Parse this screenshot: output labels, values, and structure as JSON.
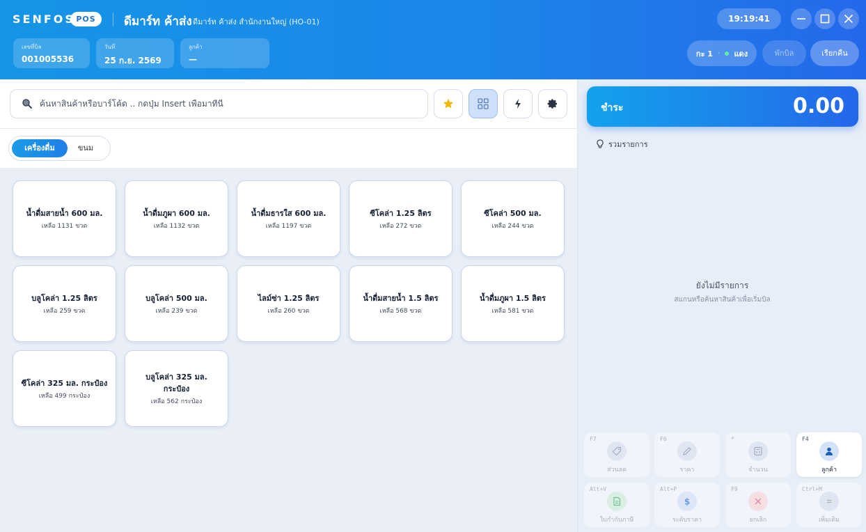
{
  "header": {
    "brand": "SENFOS",
    "badge": "POS",
    "store_name": "ดีมาร์ท ค้าส่ง",
    "branch": "ดีมาร์ท ค้าส่ง สำนักงานใหญ่ (HO-01)",
    "bill_label": "เลขที่บิล",
    "bill_value": "001005536",
    "date_label": "วันที่",
    "date_value": "25 ก.ย. 2569",
    "customer_label": "ลูกค้า",
    "customer_value": "—",
    "time": "19:19:41",
    "shift": "กะ 1",
    "shift_sep": "·",
    "cashier": "แดง",
    "hold_label": "พักบิล",
    "recall_label": "เรียกคืน"
  },
  "search": {
    "placeholder": "ค้นหาสินค้าหรือบาร์โค้ด .. กดปุ่ม Insert เพื่อมาที่นี่"
  },
  "categories": [
    {
      "label": "เครื่องดื่ม"
    },
    {
      "label": "ขนม"
    }
  ],
  "products": [
    {
      "name": "น้ำดื่มสายน้ำ 600 มล.",
      "stock": "เหลือ 1131 ขวด"
    },
    {
      "name": "น้ำดื่มภูผา 600 มล.",
      "stock": "เหลือ 1132 ขวด"
    },
    {
      "name": "น้ำดื่มธารใส 600 มล.",
      "stock": "เหลือ 1197 ขวด"
    },
    {
      "name": "ซีโคล่า 1.25 ลิตร",
      "stock": "เหลือ 272 ขวด"
    },
    {
      "name": "ซีโคล่า 500 มล.",
      "stock": "เหลือ 244 ขวด"
    },
    {
      "name": "บลูโคล่า 1.25 ลิตร",
      "stock": "เหลือ 259 ขวด"
    },
    {
      "name": "บลูโคล่า 500 มล.",
      "stock": "เหลือ 239 ขวด"
    },
    {
      "name": "ไลม์ซ่า 1.25 ลิตร",
      "stock": "เหลือ 260 ขวด"
    },
    {
      "name": "น้ำดื่มสายน้ำ 1.5 ลิตร",
      "stock": "เหลือ 568 ขวด"
    },
    {
      "name": "น้ำดื่มภูผา 1.5 ลิตร",
      "stock": "เหลือ 581 ขวด"
    },
    {
      "name": "ซีโคล่า 325 มล. กระป๋อง",
      "stock": "เหลือ 499 กระป๋อง"
    },
    {
      "name": "บลูโคล่า 325 มล. กระป๋อง",
      "stock": "เหลือ 562 กระป๋อง"
    }
  ],
  "cart": {
    "pay_label": "ชำระ",
    "total": "0.00",
    "summary_label": "รวมรายการ",
    "empty_title": "ยังไม่มีรายการ",
    "empty_subtitle": "สแกนหรือค้นหาสินค้าเพื่อเริ่มบิล"
  },
  "actions": [
    {
      "key": "F7",
      "label": "ส่วนลด",
      "icon": "tag-icon"
    },
    {
      "key": "F6",
      "label": "ราคา",
      "icon": "pencil-icon"
    },
    {
      "key": "*",
      "label": "จำนวน",
      "icon": "calculator-icon"
    },
    {
      "key": "F4",
      "label": "ลูกค้า",
      "icon": "user-icon"
    },
    {
      "key": "Alt+V",
      "label": "ใบกำกับภาษี",
      "icon": "document-icon"
    },
    {
      "key": "Alt+P",
      "label": "ระดับราคา",
      "icon": "dollar-icon"
    },
    {
      "key": "F9",
      "label": "ยกเลิก",
      "icon": "close-icon"
    },
    {
      "key": "Ctrl+M",
      "label": "เพิ่มเติม",
      "icon": "menu-icon"
    }
  ],
  "colors": {
    "accent": "#1c86ea",
    "header_start": "#1595e6",
    "header_end": "#2468ea",
    "star": "#f5b800"
  }
}
